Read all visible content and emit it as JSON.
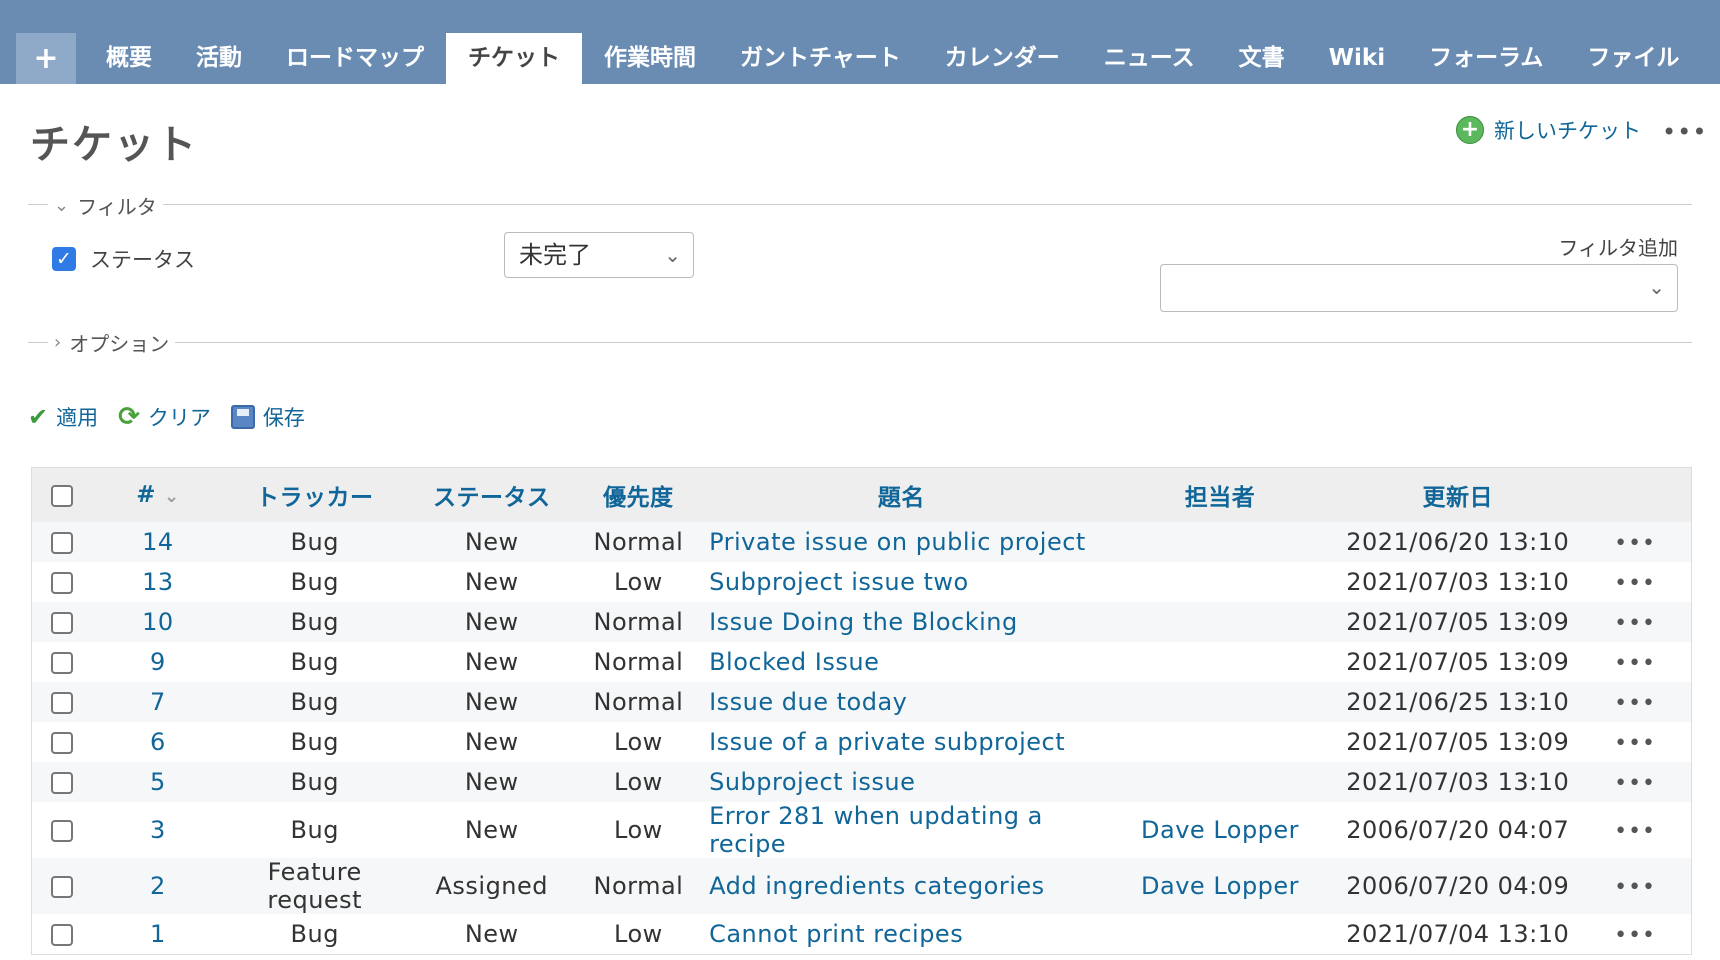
{
  "tabs": [
    "+",
    "概要",
    "活動",
    "ロードマップ",
    "チケット",
    "作業時間",
    "ガントチャート",
    "カレンダー",
    "ニュース",
    "文書",
    "Wiki",
    "フォーラム",
    "ファイル"
  ],
  "selected_tab": "チケット",
  "page": {
    "title": "チケット",
    "new_issue_label": "新しいチケット",
    "ellipsis": "•••"
  },
  "filters": {
    "legend": "フィルタ",
    "status_label": "ステータス",
    "status_checked": true,
    "status_value": "未完了",
    "add_filter_label": "フィルタ追加",
    "add_filter_value": ""
  },
  "options": {
    "legend": "オプション"
  },
  "actions": {
    "apply": "適用",
    "clear": "クリア",
    "save": "保存"
  },
  "table": {
    "headers": {
      "id": "#",
      "tracker": "トラッカー",
      "status": "ステータス",
      "priority": "優先度",
      "subject": "題名",
      "assignee": "担当者",
      "updated": "更新日"
    },
    "rows": [
      {
        "id": "14",
        "tracker": "Bug",
        "status": "New",
        "priority": "Normal",
        "subject": "Private issue on public project",
        "assignee": "",
        "updated": "2021/06/20 13:10"
      },
      {
        "id": "13",
        "tracker": "Bug",
        "status": "New",
        "priority": "Low",
        "subject": "Subproject issue two",
        "assignee": "",
        "updated": "2021/07/03 13:10"
      },
      {
        "id": "10",
        "tracker": "Bug",
        "status": "New",
        "priority": "Normal",
        "subject": "Issue Doing the Blocking",
        "assignee": "",
        "updated": "2021/07/05 13:09"
      },
      {
        "id": "9",
        "tracker": "Bug",
        "status": "New",
        "priority": "Normal",
        "subject": "Blocked Issue",
        "assignee": "",
        "updated": "2021/07/05 13:09"
      },
      {
        "id": "7",
        "tracker": "Bug",
        "status": "New",
        "priority": "Normal",
        "subject": "Issue due today",
        "assignee": "",
        "updated": "2021/06/25 13:10"
      },
      {
        "id": "6",
        "tracker": "Bug",
        "status": "New",
        "priority": "Low",
        "subject": "Issue of a private subproject",
        "assignee": "",
        "updated": "2021/07/05 13:09"
      },
      {
        "id": "5",
        "tracker": "Bug",
        "status": "New",
        "priority": "Low",
        "subject": "Subproject issue",
        "assignee": "",
        "updated": "2021/07/03 13:10"
      },
      {
        "id": "3",
        "tracker": "Bug",
        "status": "New",
        "priority": "Low",
        "subject": "Error 281 when updating a recipe",
        "assignee": "Dave Lopper",
        "updated": "2006/07/20 04:07"
      },
      {
        "id": "2",
        "tracker": "Feature request",
        "status": "Assigned",
        "priority": "Normal",
        "subject": "Add ingredients categories",
        "assignee": "Dave Lopper",
        "updated": "2006/07/20 04:09"
      },
      {
        "id": "1",
        "tracker": "Bug",
        "status": "New",
        "priority": "Low",
        "subject": "Cannot print recipes",
        "assignee": "",
        "updated": "2021/07/04 13:10"
      }
    ]
  },
  "colors": {
    "tabbar": "#6a8cb3",
    "link": "#116699",
    "checkbox_accent": "#2f7ae5"
  }
}
